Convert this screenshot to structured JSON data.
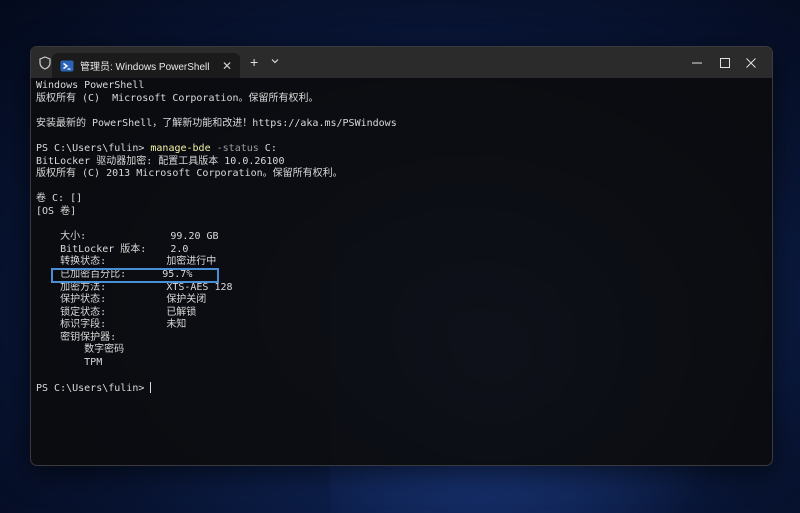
{
  "window": {
    "tab_title": "管理员: Windows PowerShell",
    "tab_close": "✕",
    "new_tab": "+",
    "icons": [
      "shield-icon",
      "powershell-icon",
      "chevron-down-icon",
      "minimize-icon",
      "maximize-icon",
      "close-icon"
    ]
  },
  "console": {
    "banner_1": "Windows PowerShell",
    "banner_2": "版权所有 (C)  Microsoft Corporation。保留所有权利。",
    "banner_3": "安装最新的 PowerShell，了解新功能和改进！https://aka.ms/PSWindows",
    "prompt_1": "PS C:\\Users\\fulin> ",
    "cmd_name": "manage-bde",
    "cmd_param": " -status",
    "cmd_arg": " C:",
    "out_1": "BitLocker 驱动器加密: 配置工具版本 10.0.26100",
    "out_2": "版权所有 (C) 2013 Microsoft Corporation。保留所有权利。",
    "volume": "卷 C: []",
    "os_volume": "[OS 卷]",
    "rows": [
      {
        "label": "    大小:              ",
        "value": "99.20 GB"
      },
      {
        "label": "    BitLocker 版本:    ",
        "value": "2.0"
      },
      {
        "label": "    转换状态:          ",
        "value": "加密进行中"
      },
      {
        "label": "    已加密百分比:      ",
        "value": "95.7%"
      },
      {
        "label": "    加密方法:          ",
        "value": "XTS-AES 128"
      },
      {
        "label": "    保护状态:          ",
        "value": "保护关闭"
      },
      {
        "label": "    锁定状态:          ",
        "value": "已解锁"
      },
      {
        "label": "    标识字段:          ",
        "value": "未知"
      },
      {
        "label": "    密钥保护器:",
        "value": ""
      },
      {
        "label": "        数字密码",
        "value": ""
      },
      {
        "label": "        TPM",
        "value": ""
      }
    ],
    "prompt_2": "PS C:\\Users\\fulin> "
  },
  "colors": {
    "highlight_box": "#4a8fd6",
    "command": "#f3f3a6"
  }
}
